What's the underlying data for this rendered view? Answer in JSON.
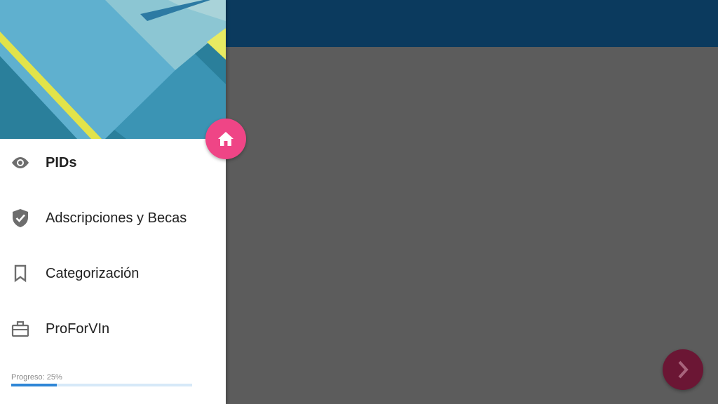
{
  "nav": {
    "items": [
      {
        "label": "PIDs",
        "icon": "eye-icon",
        "active": true
      },
      {
        "label": "Adscripciones y Becas",
        "icon": "shield-check-icon",
        "active": false
      },
      {
        "label": "Categorización",
        "icon": "bookmark-icon",
        "active": false
      },
      {
        "label": "ProForVIn",
        "icon": "briefcase-icon",
        "active": false
      }
    ]
  },
  "progress": {
    "text": "Progreso: 25%",
    "value_percent": 25
  },
  "fab": {
    "icon": "home-icon"
  },
  "next": {
    "icon": "chevron-right-icon"
  },
  "colors": {
    "appbar": "#0b3a5e",
    "content": "#5c5c5c",
    "fab": "#ef4586",
    "next_button": "#6b1634",
    "progress_fill": "#2e86d6",
    "progress_track": "#d6e9f8"
  }
}
